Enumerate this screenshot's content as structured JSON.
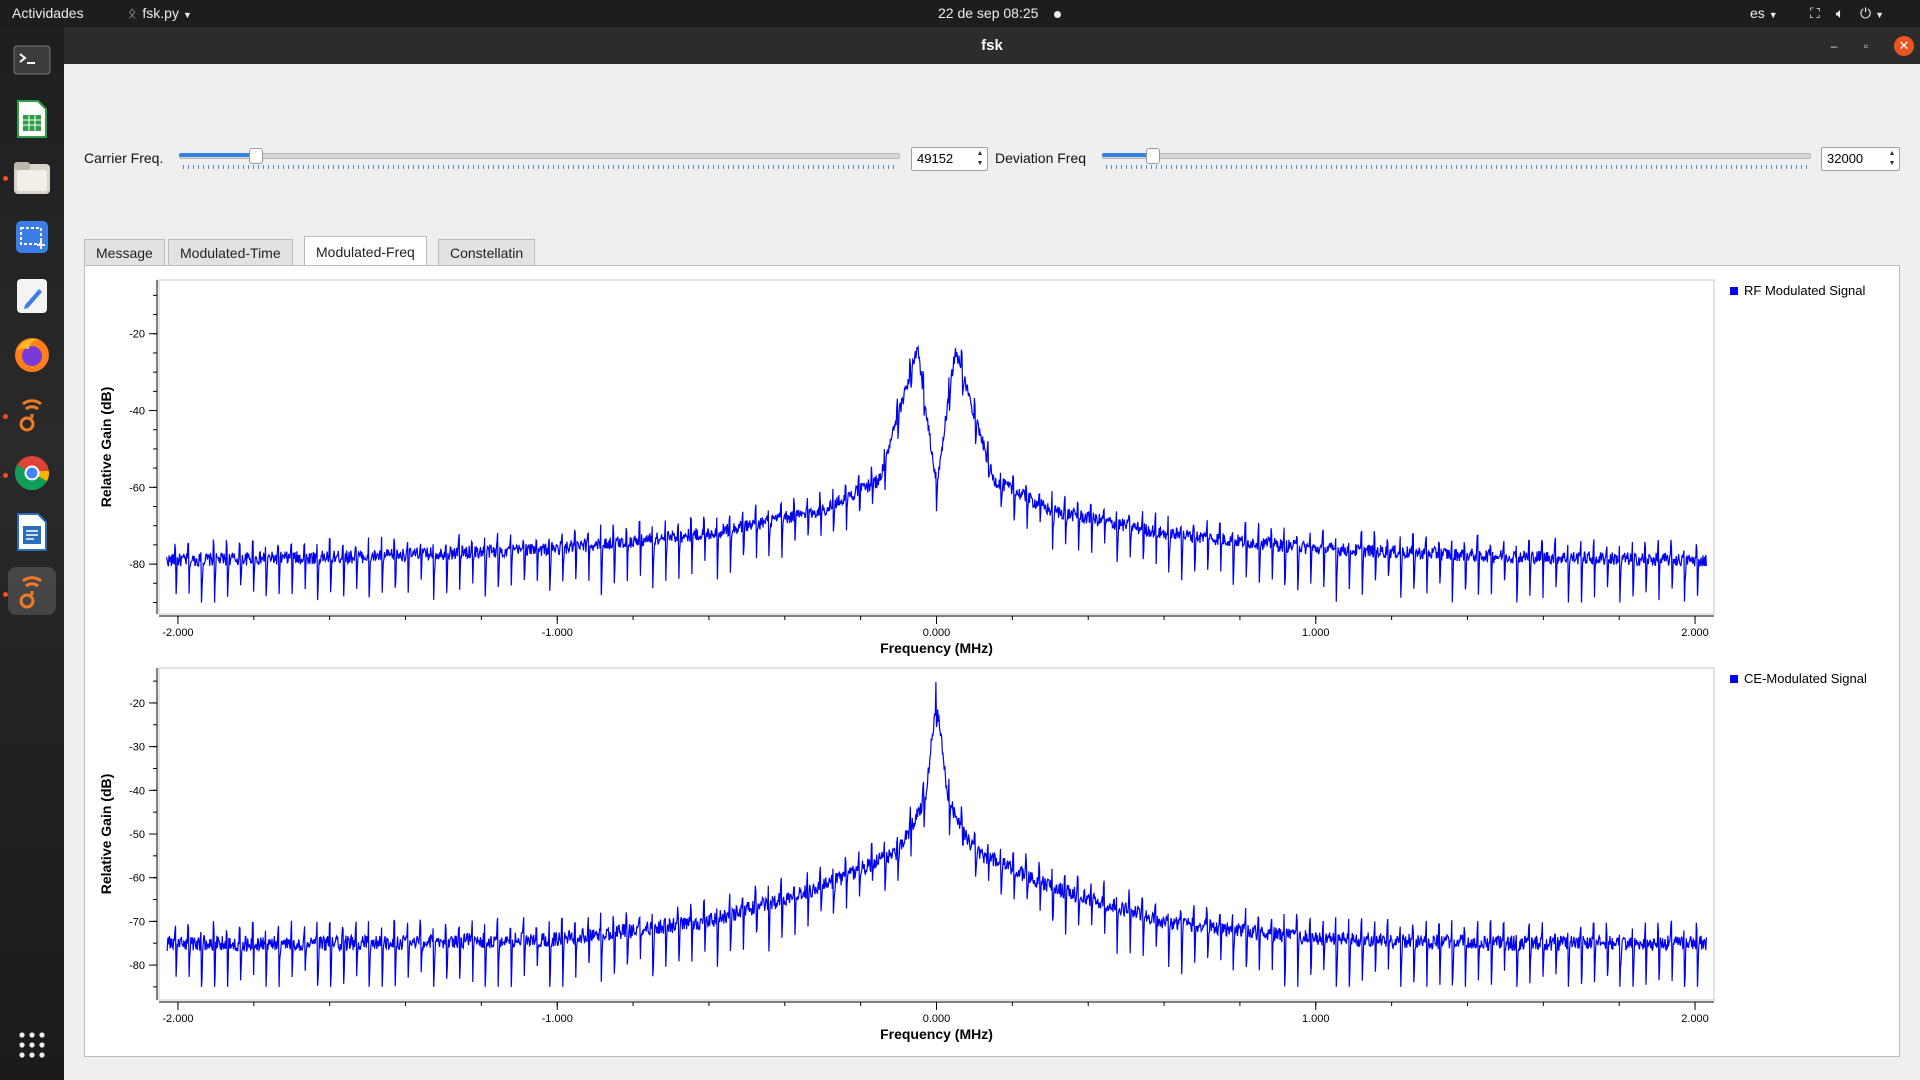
{
  "topbar": {
    "activities": "Actividades",
    "app_menu": "fsk.py",
    "datetime": "22 de sep  08:25",
    "lang": "es"
  },
  "window": {
    "title": "fsk"
  },
  "controls": {
    "carrier": {
      "label": "Carrier Freq.",
      "value": "49152",
      "level": 0.105
    },
    "deviation": {
      "label": "Deviation Freq",
      "value": "32000",
      "level": 0.07
    }
  },
  "tabs": [
    "Message",
    "Modulated-Time",
    "Modulated-Freq",
    "Constellatin"
  ],
  "active_tab": "Modulated-Freq",
  "dock": [
    "terminal-icon",
    "spreadsheet-icon",
    "files-icon",
    "screenshot-icon",
    "text-editor-icon",
    "firefox-icon",
    "gnuradio-icon",
    "chrome-icon",
    "writer-icon",
    "gnuradio-icon"
  ],
  "colors": {
    "trace": "#0000ee",
    "accent": "#3584e4",
    "close": "#e95420"
  },
  "chart_data": [
    {
      "type": "line",
      "xlabel": "Frequency (MHz)",
      "ylabel": "Relative Gain (dB)",
      "legend": "RF Modulated Signal",
      "legend_position": "top-right",
      "x_ticks": [
        "-2.000",
        "-1.000",
        "0.000",
        "1.000",
        "2.000"
      ],
      "y_ticks": [
        "-20",
        "-40",
        "-60",
        "-80"
      ],
      "xlim": [
        -2.05,
        2.05
      ],
      "ylim": [
        -93,
        -6
      ],
      "x": [
        -2.0,
        -1.5,
        -1.0,
        -0.6,
        -0.3,
        -0.15,
        -0.05,
        0.0,
        0.05,
        0.15,
        0.3,
        0.6,
        1.0,
        1.5,
        2.0
      ],
      "y": [
        -79,
        -78,
        -76,
        -72,
        -66,
        -58,
        -24,
        -60,
        -24,
        -58,
        -66,
        -72,
        -76,
        -78,
        -79
      ]
    },
    {
      "type": "line",
      "xlabel": "Frequency (MHz)",
      "ylabel": "Relative Gain (dB)",
      "legend": "CE-Modulated Signal",
      "legend_position": "top-right",
      "x_ticks": [
        "-2.000",
        "-1.000",
        "0.000",
        "1.000",
        "2.000"
      ],
      "y_ticks": [
        "-20",
        "-30",
        "-40",
        "-50",
        "-60",
        "-70",
        "-80"
      ],
      "xlim": [
        -2.05,
        2.05
      ],
      "ylim": [
        -88,
        -12
      ],
      "x": [
        -2.0,
        -1.5,
        -1.0,
        -0.6,
        -0.3,
        -0.1,
        -0.03,
        0.0,
        0.03,
        0.1,
        0.3,
        0.6,
        1.0,
        1.5,
        2.0
      ],
      "y": [
        -75,
        -75,
        -74,
        -70,
        -62,
        -54,
        -42,
        -19,
        -42,
        -54,
        -62,
        -70,
        -74,
        -75,
        -75
      ]
    }
  ]
}
